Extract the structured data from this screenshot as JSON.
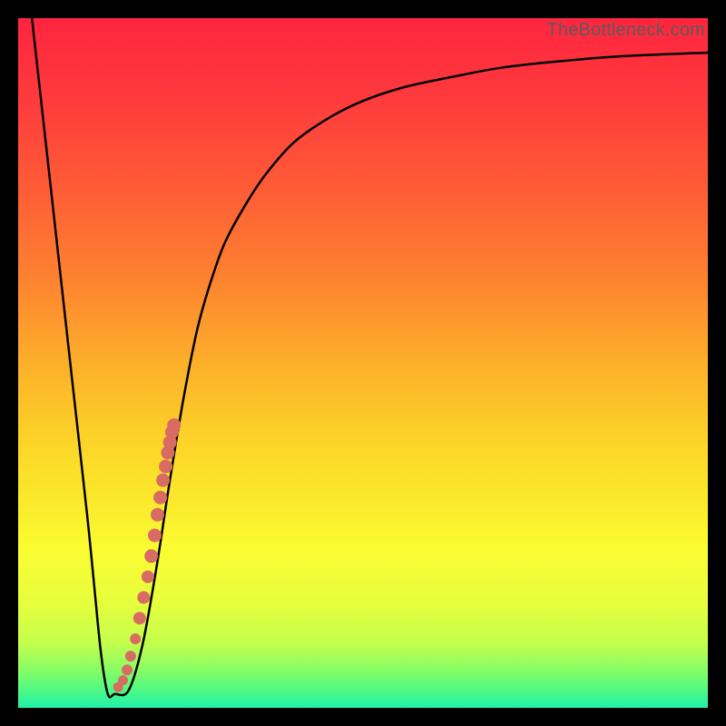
{
  "watermark": "TheBottleneck.com",
  "colors": {
    "frame": "#000000",
    "curve": "#000000",
    "marker": "#d96c62",
    "gradient_stops": [
      {
        "offset": 0.0,
        "color": "#fe253f"
      },
      {
        "offset": 0.12,
        "color": "#fe3b3c"
      },
      {
        "offset": 0.25,
        "color": "#fe5d36"
      },
      {
        "offset": 0.38,
        "color": "#fe8330"
      },
      {
        "offset": 0.5,
        "color": "#fdaf2a"
      },
      {
        "offset": 0.62,
        "color": "#fcd628"
      },
      {
        "offset": 0.7,
        "color": "#fbe92b"
      },
      {
        "offset": 0.77,
        "color": "#fbfc32"
      },
      {
        "offset": 0.85,
        "color": "#e6fe3d"
      },
      {
        "offset": 0.905,
        "color": "#c4ff4c"
      },
      {
        "offset": 0.945,
        "color": "#88fd64"
      },
      {
        "offset": 0.975,
        "color": "#4ef985"
      },
      {
        "offset": 1.0,
        "color": "#1ef1a9"
      }
    ]
  },
  "chart_data": {
    "type": "line",
    "title": "",
    "xlabel": "",
    "ylabel": "",
    "xlim": [
      0,
      100
    ],
    "ylim": [
      0,
      100
    ],
    "grid": false,
    "legend": false,
    "series": [
      {
        "name": "bottleneck-curve",
        "x": [
          2.0,
          4.0,
          6.0,
          8.0,
          10.0,
          11.0,
          12.0,
          13.0,
          14.0,
          16.0,
          18.0,
          20.0,
          22.0,
          24.0,
          26.0,
          28.0,
          30.0,
          33.0,
          36.0,
          40.0,
          45.0,
          50.0,
          56.0,
          63.0,
          70.0,
          78.0,
          88.0,
          100.0
        ],
        "y": [
          100.0,
          82.0,
          64.0,
          46.0,
          28.0,
          18.0,
          8.0,
          2.0,
          2.0,
          2.5,
          9.0,
          20.0,
          33.0,
          45.0,
          55.0,
          62.0,
          67.5,
          73.0,
          77.5,
          82.0,
          85.5,
          88.0,
          90.0,
          91.5,
          92.8,
          93.7,
          94.5,
          95.0
        ]
      }
    ],
    "markers": {
      "name": "highlighted-points",
      "x": [
        14.5,
        15.2,
        15.8,
        16.3,
        17.0,
        17.6,
        18.2,
        18.8,
        19.3,
        19.8,
        20.2,
        20.6,
        21.0,
        21.4,
        21.7,
        22.0,
        22.3,
        22.6
      ],
      "y": [
        3.0,
        4.0,
        5.5,
        7.5,
        10.0,
        13.0,
        16.0,
        19.0,
        22.0,
        25.0,
        28.0,
        30.5,
        33.0,
        35.0,
        37.0,
        38.5,
        40.0,
        41.0
      ],
      "r": [
        5.5,
        5.5,
        6.0,
        6.0,
        6.0,
        7.0,
        7.0,
        7.0,
        7.5,
        7.5,
        7.5,
        7.5,
        7.5,
        7.5,
        7.5,
        7.5,
        7.5,
        7.5
      ]
    }
  }
}
